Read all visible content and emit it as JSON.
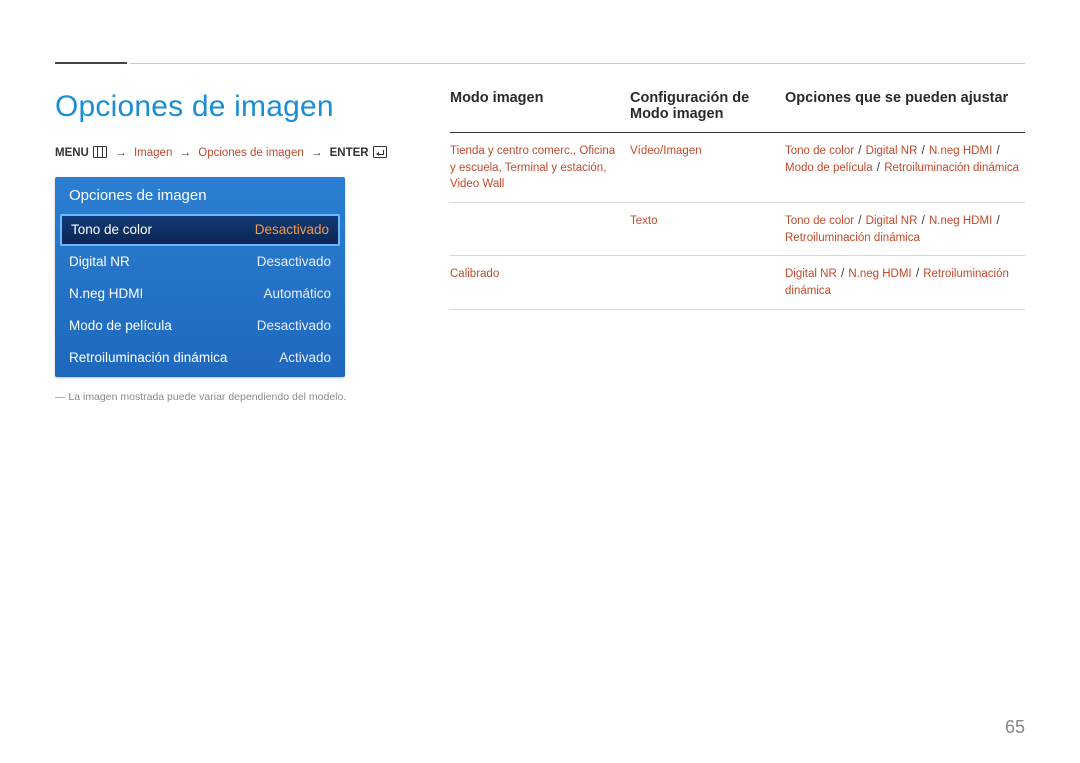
{
  "title": "Opciones de imagen",
  "breadcrumb": {
    "menu": "MENU",
    "p1": "Imagen",
    "p2": "Opciones de imagen",
    "enter": "ENTER"
  },
  "panel": {
    "header": "Opciones de imagen",
    "rows": [
      {
        "label": "Tono de color",
        "value": "Desactivado",
        "selected": true
      },
      {
        "label": "Digital NR",
        "value": "Desactivado",
        "selected": false
      },
      {
        "label": "N.neg HDMI",
        "value": "Automático",
        "selected": false
      },
      {
        "label": "Modo de película",
        "value": "Desactivado",
        "selected": false
      },
      {
        "label": "Retroiluminación dinámica",
        "value": "Activado",
        "selected": false
      }
    ]
  },
  "footnote": "―  La imagen mostrada puede variar dependiendo del modelo.",
  "table": {
    "headers": {
      "col1": "Modo imagen",
      "col2": "Configuración de Modo imagen",
      "col3": "Opciones que se pueden ajustar"
    },
    "rows": [
      {
        "c1": "Tienda y centro comerc., Oficina y escuela, Terminal y estación, Video Wall",
        "c2": "Vídeo/Imagen",
        "c3_parts": [
          "Tono de color",
          " / ",
          "Digital NR",
          " / ",
          "N.neg HDMI",
          " / ",
          "Modo de película",
          " / ",
          "Retroiluminación dinámica"
        ],
        "c3_red": [
          true,
          false,
          true,
          false,
          true,
          false,
          true,
          false,
          true
        ]
      },
      {
        "c1": "",
        "c2": "Texto",
        "c3_parts": [
          "Tono de color",
          " / ",
          "Digital NR",
          " / ",
          "N.neg HDMI",
          " / ",
          "Retroiluminación dinámica"
        ],
        "c3_red": [
          true,
          false,
          true,
          false,
          true,
          false,
          true
        ]
      },
      {
        "c1": "Calibrado",
        "c2": "",
        "c3_parts": [
          "Digital NR",
          " / ",
          "N.neg HDMI",
          " / ",
          "Retroiluminación dinámica"
        ],
        "c3_red": [
          true,
          false,
          true,
          false,
          true
        ]
      }
    ]
  },
  "pageNumber": "65"
}
